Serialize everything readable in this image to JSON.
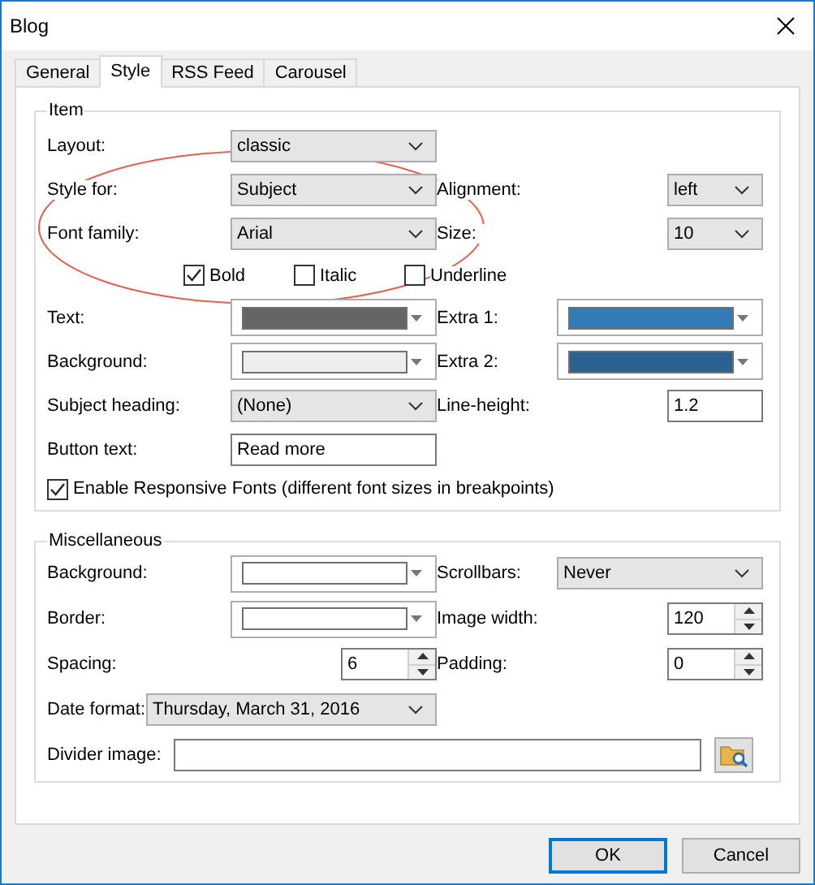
{
  "window": {
    "title": "Blog"
  },
  "tabs": [
    {
      "label": "General",
      "selected": false
    },
    {
      "label": "Style",
      "selected": true
    },
    {
      "label": "RSS Feed",
      "selected": false
    },
    {
      "label": "Carousel",
      "selected": false
    }
  ],
  "sections": [
    {
      "title": "Item",
      "rows": [
        {
          "kind": "fields",
          "left": {
            "label": "Layout:",
            "kind": "dropdown",
            "value": "classic"
          }
        },
        {
          "kind": "fields",
          "left": {
            "label": "Style for:",
            "kind": "dropdown",
            "value": "Subject"
          },
          "right": {
            "label": "Alignment:",
            "kind": "dropdown",
            "value": "left"
          }
        },
        {
          "kind": "fields",
          "left": {
            "label": "Font family:",
            "kind": "dropdown",
            "value": "Arial"
          },
          "right": {
            "label": "Size:",
            "kind": "dropdown",
            "value": "10"
          }
        },
        {
          "kind": "checks",
          "items": [
            {
              "label": "Bold",
              "checked": true
            },
            {
              "label": "Italic",
              "checked": false
            },
            {
              "label": "Underline",
              "checked": false
            }
          ]
        },
        {
          "kind": "fields",
          "left": {
            "label": "Text:",
            "kind": "color",
            "color": "#656565"
          },
          "right": {
            "label": "Extra 1:",
            "kind": "color",
            "color": "#337ab7"
          }
        },
        {
          "kind": "fields",
          "left": {
            "label": "Background:",
            "kind": "color",
            "color": "#eeeeee"
          },
          "right": {
            "label": "Extra 2:",
            "kind": "color",
            "color": "#2d6190"
          }
        },
        {
          "kind": "fields",
          "left": {
            "label": "Subject heading:",
            "kind": "dropdown",
            "value": "(None)"
          },
          "right": {
            "label": "Line-height:",
            "kind": "input",
            "value": "1.2"
          }
        },
        {
          "kind": "fields",
          "left": {
            "label": "Button text:",
            "kind": "input",
            "value": "Read more"
          }
        },
        {
          "kind": "checkbox",
          "label": "Enable Responsive Fonts (different font sizes in breakpoints)",
          "checked": true
        }
      ]
    },
    {
      "title": "Miscellaneous",
      "rows": [
        {
          "kind": "fields",
          "left": {
            "label": "Background:",
            "kind": "color",
            "color": "#ffffff"
          },
          "right": {
            "label": "Scrollbars:",
            "kind": "dropdown",
            "value": "Never"
          }
        },
        {
          "kind": "fields",
          "left": {
            "label": "Border:",
            "kind": "color",
            "color": "#ffffff"
          },
          "right": {
            "label": "Image width:",
            "kind": "spin",
            "value": "120"
          }
        },
        {
          "kind": "fields",
          "left": {
            "label": "Spacing:",
            "kind": "spin",
            "value": "6"
          },
          "right": {
            "label": "Padding:",
            "kind": "spin",
            "value": "0"
          }
        },
        {
          "kind": "fields",
          "left": {
            "label": "Date format:",
            "kind": "dropdown",
            "value": "Thursday, March 31, 2016"
          }
        },
        {
          "kind": "fields",
          "left": {
            "label": "Divider image:",
            "kind": "file"
          }
        }
      ]
    }
  ],
  "buttons": [
    {
      "label": "OK",
      "default": true
    },
    {
      "label": "Cancel",
      "default": false
    }
  ]
}
